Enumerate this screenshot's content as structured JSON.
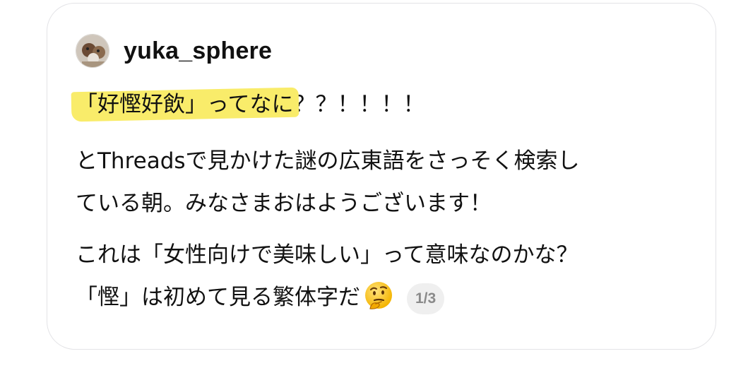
{
  "post": {
    "username": "yuka_sphere",
    "line1_highlight": "「好慳好飲」ってなに",
    "line1_rest": "？？！！！！",
    "para2_line1": "とThreadsで見かけた謎の広東語をさっそく検索し",
    "para2_line2": "ている朝。みなさまおはようございます！",
    "para3_line1": "これは「女性向けで美味しい」って意味なのかな？",
    "para3_line2": "「慳」は初めて見る繁体字だ",
    "emoji_icon": "thinking-face-emoji",
    "page_counter": "1/3"
  },
  "colors": {
    "highlight": "#f9ec6a",
    "card_border": "#e3e3e6",
    "counter_bg": "#efefef",
    "counter_text": "#8a8a8a"
  }
}
